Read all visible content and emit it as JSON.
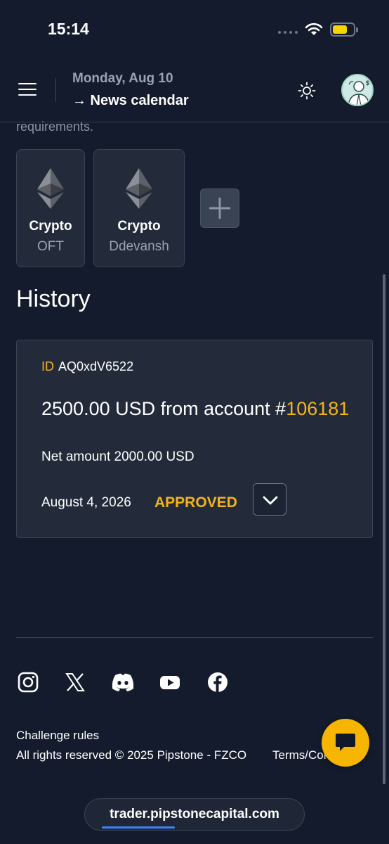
{
  "status_bar": {
    "time": "15:14"
  },
  "header": {
    "date": "Monday, Aug 10",
    "news_link": "→ News calendar"
  },
  "intro_tail": "requirements.",
  "wallets": [
    {
      "type": "Crypto",
      "name": "OFT",
      "icon": "ethereum-icon"
    },
    {
      "type": "Crypto",
      "name": "Ddevansh",
      "icon": "ethereum-icon"
    }
  ],
  "history": {
    "title": "History",
    "items": [
      {
        "id_label": "ID",
        "id_value": "AQ0xdV6522",
        "amount_text": "2500.00 USD from account #",
        "account": "106181",
        "net_amount": "Net amount 2000.00 USD",
        "date": "August 4, 2026",
        "status": "APPROVED"
      }
    ]
  },
  "footer": {
    "social_icons": [
      "instagram-icon",
      "x-icon",
      "discord-icon",
      "youtube-icon",
      "facebook-icon"
    ],
    "challenge_rules": "Challenge rules",
    "copyright": "All rights reserved © 2025 Pipstone - FZCO",
    "terms": "Terms/Conditions"
  },
  "browser": {
    "url": "trader.pipstonecapital.com"
  },
  "colors": {
    "accent": "#f2b41c",
    "background": "#141b2c",
    "card": "#232b3b",
    "chat": "#f7b500"
  }
}
